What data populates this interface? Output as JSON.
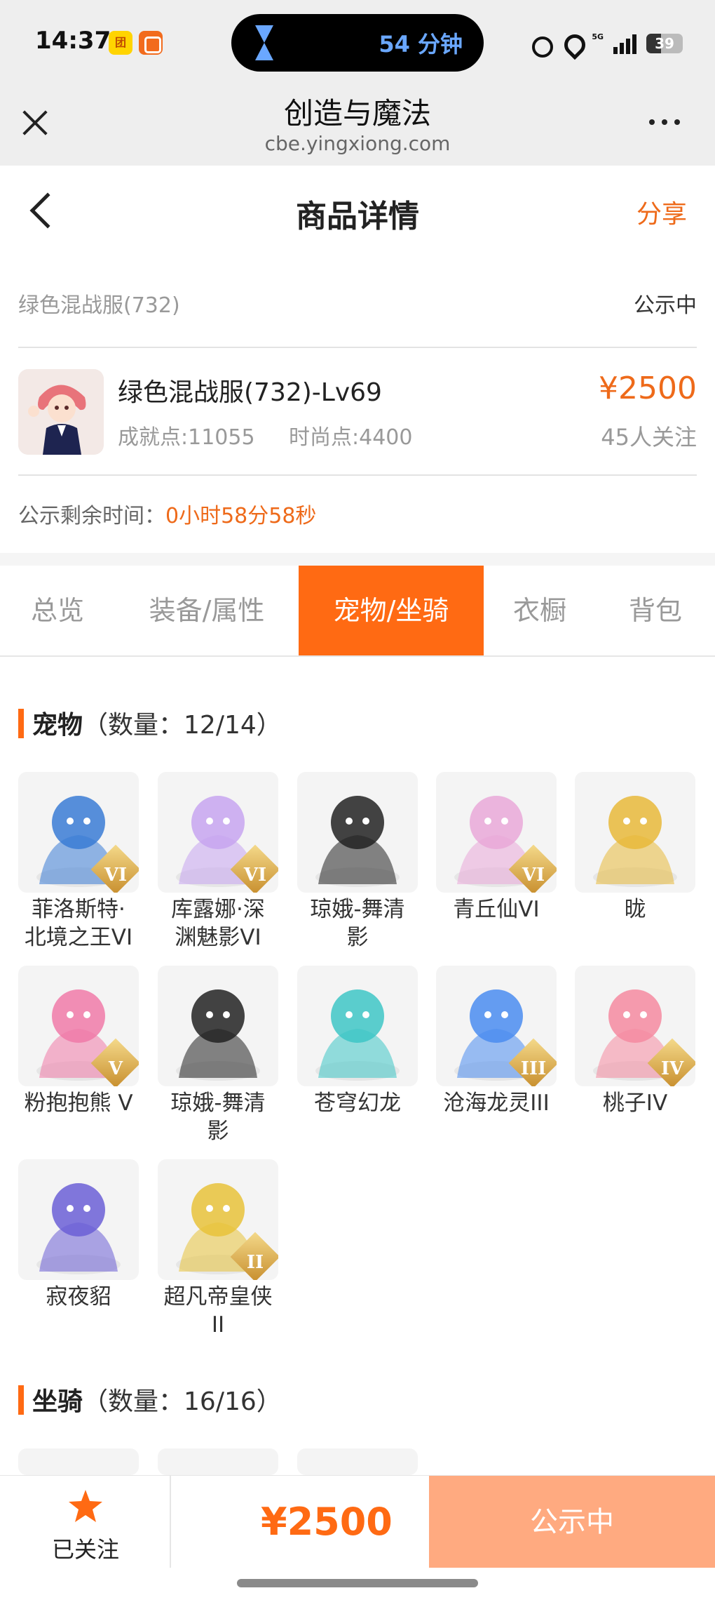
{
  "status_bar": {
    "time": "14:37",
    "app1": "团",
    "island_text": "54 分钟",
    "network": "5G",
    "battery": "39"
  },
  "browser": {
    "title": "创造与魔法",
    "url": "cbe.yingxiong.com"
  },
  "header": {
    "title": "商品详情",
    "share": "分享"
  },
  "listing": {
    "name": "绿色混战服(732)",
    "status": "公示中",
    "item_title": "绿色混战服(732)-Lv69",
    "achievement": "成就点:11055",
    "fashion": "时尚点:4400",
    "price": "¥2500",
    "followers": "45人关注",
    "countdown_label": "公示剩余时间：",
    "countdown_value": "0小时58分58秒"
  },
  "tabs": [
    {
      "label": "总览"
    },
    {
      "label": "装备/属性"
    },
    {
      "label": "宠物/坐骑"
    },
    {
      "label": "衣橱"
    },
    {
      "label": "背包"
    }
  ],
  "active_tab": "宠物/坐骑",
  "pets": {
    "title": "宠物",
    "count": "（数量：12/14）",
    "items": [
      {
        "name": "菲洛斯特·北境之王VI",
        "line1": "菲洛斯特·",
        "line2": "北境之王VI",
        "badge": "VI",
        "color": "#3a7bd5"
      },
      {
        "name": "库露娜·深渊魅影VI",
        "line1": "库露娜·深",
        "line2": "渊魅影VI",
        "badge": "VI",
        "color": "#c7a4f0"
      },
      {
        "name": "琼娥-舞清影",
        "line1": "琼娥-舞清",
        "line2": "影",
        "badge": "",
        "color": "#222222"
      },
      {
        "name": "青丘仙VI",
        "line1": "青丘仙VI",
        "line2": "",
        "badge": "VI",
        "color": "#e9a8d8"
      },
      {
        "name": "昽",
        "line1": "昽",
        "line2": "",
        "badge": "",
        "color": "#e8b93a"
      },
      {
        "name": "粉抱抱熊 V",
        "line1": "粉抱抱熊 V",
        "line2": "",
        "badge": "V",
        "color": "#f07aa8"
      },
      {
        "name": "琼娥-舞清影",
        "line1": "琼娥-舞清",
        "line2": "影",
        "badge": "",
        "color": "#222222"
      },
      {
        "name": "苍穹幻龙",
        "line1": "苍穹幻龙",
        "line2": "",
        "badge": "",
        "color": "#3ec6c6"
      },
      {
        "name": "沧海龙灵III",
        "line1": "沧海龙灵III",
        "line2": "",
        "badge": "III",
        "color": "#4a8cf0"
      },
      {
        "name": "桃子IV",
        "line1": "桃子IV",
        "line2": "",
        "badge": "IV",
        "color": "#f58aa0"
      },
      {
        "name": "寂夜貂",
        "line1": "寂夜貂",
        "line2": "",
        "badge": "",
        "color": "#6b5fd6"
      },
      {
        "name": "超凡帝皇侠II",
        "line1": "超凡帝皇侠",
        "line2": "II",
        "badge": "II",
        "color": "#e8c23a"
      }
    ]
  },
  "mounts": {
    "title": "坐骑",
    "count": "（数量：16/16）"
  },
  "bottom_bar": {
    "follow_label": "已关注",
    "price": "¥2500",
    "action": "公示中"
  },
  "colors": {
    "accent": "#ff6a13",
    "price": "#ee6a1a",
    "action_disabled": "#ffaa80"
  }
}
